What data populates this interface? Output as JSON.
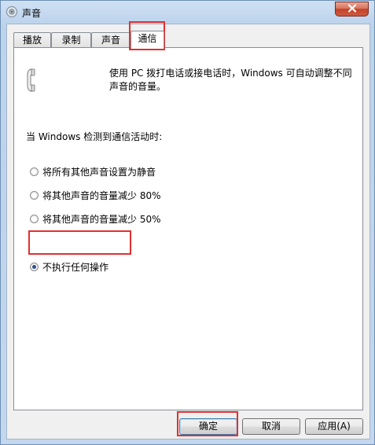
{
  "window": {
    "title": "声音"
  },
  "tabs": [
    {
      "label": "播放"
    },
    {
      "label": "录制"
    },
    {
      "label": "声音"
    },
    {
      "label": "通信"
    }
  ],
  "panel": {
    "description": "使用 PC 拨打电话或接电话时，Windows 可自动调整不同声音的音量。",
    "prompt": "当 Windows 检测到通信活动时:",
    "options": [
      {
        "label": "将所有其他声音设置为静音",
        "checked": false
      },
      {
        "label": "将其他声音的音量减少 80%",
        "checked": false
      },
      {
        "label": "将其他声音的音量减少 50%",
        "checked": false
      },
      {
        "label": "不执行任何操作",
        "checked": true
      }
    ]
  },
  "buttons": {
    "ok": "确定",
    "cancel": "取消",
    "apply": "应用(A)"
  },
  "colors": {
    "highlight": "#e23030",
    "titlebar": "#c3d7ee",
    "close": "#c1432a"
  },
  "icons": {
    "app": "speaker-icon",
    "phone": "telephone-handset-icon",
    "close": "close-icon"
  }
}
